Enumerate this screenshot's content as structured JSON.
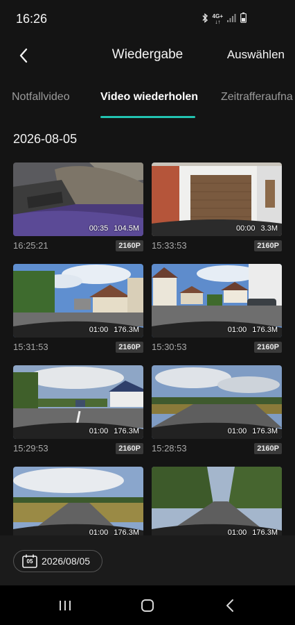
{
  "status_bar": {
    "time": "16:26",
    "network": "4G+",
    "icons": [
      "bluetooth-icon",
      "mobile-data-icon",
      "signal-icon",
      "battery-icon"
    ]
  },
  "header": {
    "back_icon": "back-chevron-icon",
    "title": "Wiedergabe",
    "select_label": "Auswählen"
  },
  "tabs": [
    {
      "label": "Notfallvideo",
      "active": false
    },
    {
      "label": "Video wiederholen",
      "active": true
    },
    {
      "label": "Zeitrafferaufna",
      "active": false
    }
  ],
  "accent_color": "#22c3b1",
  "date_group": "2026-08-05",
  "videos": [
    {
      "duration": "00:35",
      "size": "104.5M",
      "time": "16:25:21",
      "resolution": "2160P"
    },
    {
      "duration": "00:00",
      "size": "3.3M",
      "time": "15:33:53",
      "resolution": "2160P"
    },
    {
      "duration": "01:00",
      "size": "176.3M",
      "time": "15:31:53",
      "resolution": "2160P"
    },
    {
      "duration": "01:00",
      "size": "176.3M",
      "time": "15:30:53",
      "resolution": "2160P"
    },
    {
      "duration": "01:00",
      "size": "176.3M",
      "time": "15:29:53",
      "resolution": "2160P"
    },
    {
      "duration": "01:00",
      "size": "176.3M",
      "time": "15:28:53",
      "resolution": "2160P"
    },
    {
      "duration": "01:00",
      "size": "176.3M",
      "time": "",
      "resolution": ""
    },
    {
      "duration": "01:00",
      "size": "176.3M",
      "time": "",
      "resolution": ""
    }
  ],
  "date_filter": {
    "calendar_day": "05",
    "date": "2026/08/05"
  },
  "nav_bar": {
    "icons": [
      "recents-icon",
      "home-icon",
      "back-icon"
    ]
  }
}
